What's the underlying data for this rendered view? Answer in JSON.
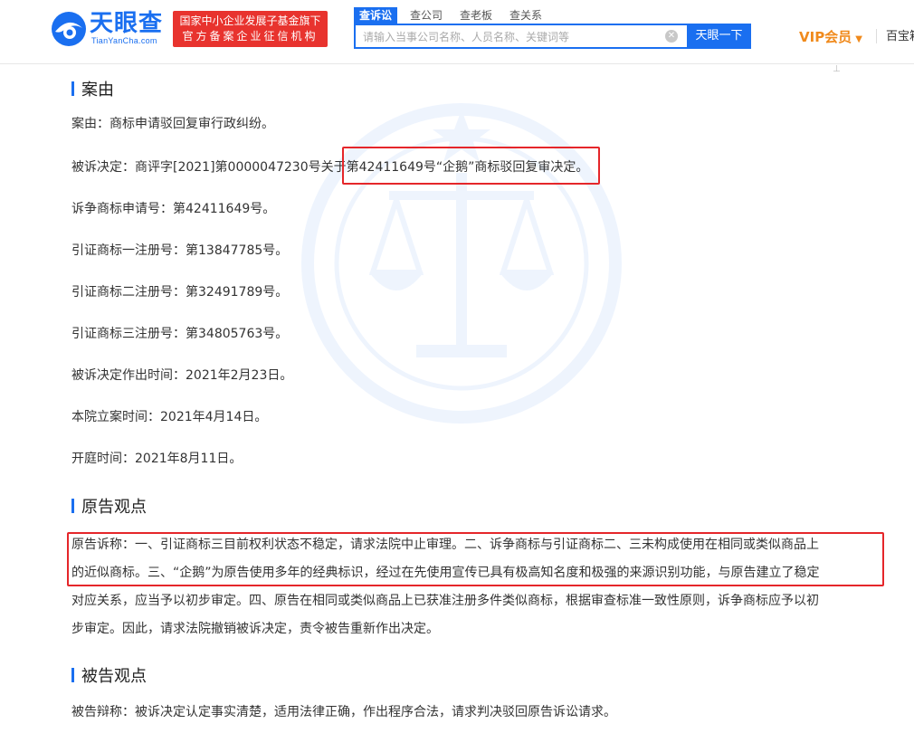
{
  "brand": {
    "name": "天眼查",
    "domain": "TianYanCha.com",
    "badge_line1": "国家中小企业发展子基金旗下",
    "badge_line2": "官方备案企业征信机构",
    "color": "#1a6ff0"
  },
  "search": {
    "tabs": [
      "查诉讼",
      "查公司",
      "查老板",
      "查关系"
    ],
    "active_tab": "查诉讼",
    "placeholder": "请输入当事公司名称、人员名称、关键词等",
    "button_label": "天眼一下"
  },
  "header_right": {
    "vip_label": "VIP会员",
    "baibao": "百宝箱"
  },
  "sections": {
    "case": {
      "title": "案由",
      "lines": [
        "案由：商标申请驳回复审行政纠纷。",
        "被诉决定：商评字[2021]第0000047230号关于第42411649号“企鹅”商标驳回复审决定。",
        "诉争商标申请号：第42411649号。",
        "引证商标一注册号：第13847785号。",
        "引证商标二注册号：第32491789号。",
        "引证商标三注册号：第34805763号。",
        "被诉决定作出时间：2021年2月23日。",
        "本院立案时间：2021年4月14日。",
        "开庭时间：2021年8月11日。"
      ]
    },
    "plaintiff": {
      "title": "原告观点",
      "lines": [
        "原告诉称：一、引证商标三目前权利状态不稳定，请求法院中止审理。二、诉争商标与引证商标二、三未构成使用在相同或类似商品上",
        "的近似商标。三、“企鹅”为原告使用多年的经典标识，经过在先使用宣传已具有极高知名度和极强的来源识别功能，与原告建立了稳定",
        "对应关系，应当予以初步审定。四、原告在相同或类似商品上已获准注册多件类似商标，根据审查标准一致性原则，诉争商标应予以初",
        "步审定。因此，请求法院撤销被诉决定，责令被告重新作出决定。"
      ]
    },
    "defendant": {
      "title": "被告观点",
      "text": "被告辩称：被诉决定认定事实清楚，适用法律正确，作出程序合法，请求判决驳回原告诉讼请求。"
    }
  },
  "highlight_color": "#e5262a"
}
